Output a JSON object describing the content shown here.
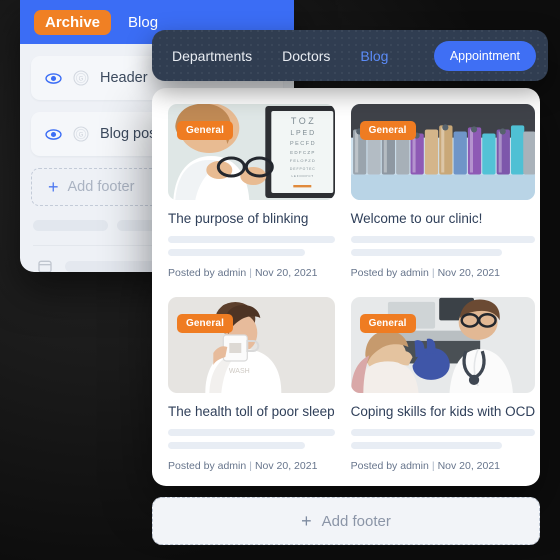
{
  "builder": {
    "tabs": [
      {
        "label": "Archive",
        "active": true
      },
      {
        "label": "Blog",
        "active": false
      }
    ],
    "layers": [
      {
        "label": "Header",
        "eye_icon": "eye-icon",
        "badge_icon": "globe-g-icon"
      },
      {
        "label": "Blog posts",
        "eye_icon": "eye-icon",
        "badge_icon": "globe-g-icon"
      }
    ],
    "add_footer_label": "Add footer",
    "plus_icon": "plus-icon"
  },
  "site_nav": {
    "links": [
      {
        "label": "Departments",
        "current": false
      },
      {
        "label": "Doctors",
        "current": false
      },
      {
        "label": "Blog",
        "current": true
      }
    ],
    "cta_label": "Appointment"
  },
  "blog": {
    "posts": [
      {
        "category": "General",
        "title": "The purpose of blinking",
        "author_text": "Posted by admin",
        "separator": "|",
        "date": "Nov 20, 2021",
        "image_alt": "woman-holding-eyeglasses-eye-chart"
      },
      {
        "category": "General",
        "title": "Welcome to our clinic!",
        "author_text": "Posted by admin",
        "separator": "|",
        "date": "Nov 20, 2021",
        "image_alt": "colored-test-tube-racks"
      },
      {
        "category": "General",
        "title": "The health toll of poor sleep",
        "author_text": "Posted by admin",
        "separator": "|",
        "date": "Nov 20, 2021",
        "image_alt": "woman-drinking-from-mug"
      },
      {
        "category": "General",
        "title": "Coping skills for kids with OCD",
        "author_text": "Posted by admin",
        "separator": "|",
        "date": "Nov 20, 2021",
        "image_alt": "doctor-high-fiving-child"
      }
    ]
  },
  "bottom_footer": {
    "label": "Add footer",
    "plus_icon": "plus-icon"
  },
  "colors": {
    "brand_blue": "#3b6df5",
    "accent_orange": "#ef7c22",
    "nav_dark": "#303d51",
    "panel_bg": "#eef1f6",
    "title_text": "#30405a",
    "meta_text": "#67758c"
  }
}
